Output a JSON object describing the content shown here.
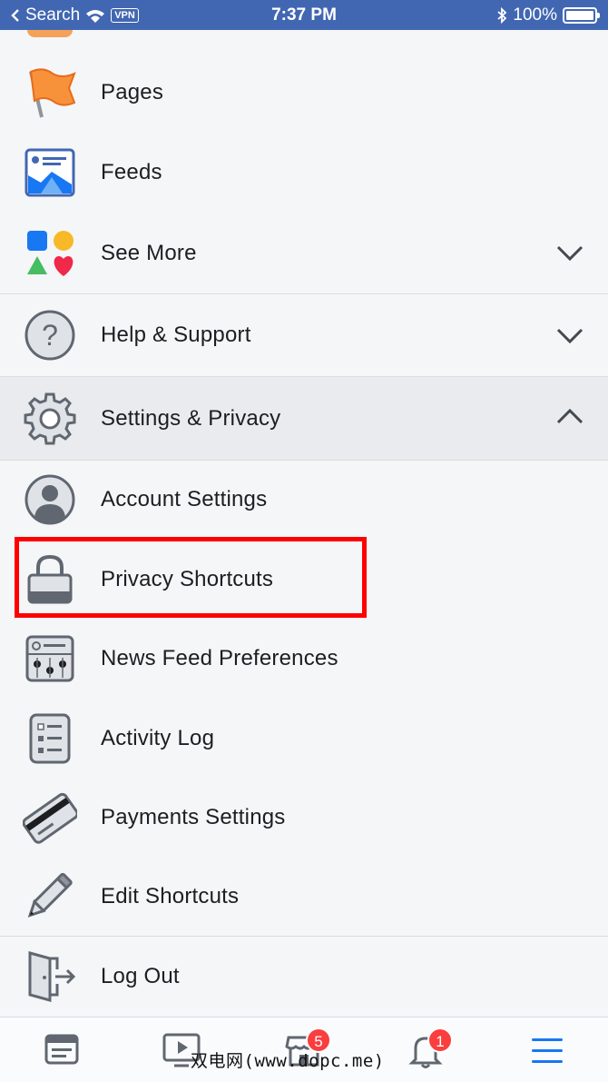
{
  "status_bar": {
    "carrier": "Search",
    "vpn": "VPN",
    "time": "7:37 PM",
    "battery": "100%",
    "icons": [
      "back-arrow-icon",
      "wifi-icon",
      "bluetooth-icon",
      "battery-icon"
    ]
  },
  "menu": {
    "items": [
      {
        "label": "Pages",
        "icon": "flag-icon"
      },
      {
        "label": "Feeds",
        "icon": "feeds-icon"
      },
      {
        "label": "See More",
        "icon": "shapes-icon",
        "chevron": "down"
      },
      {
        "label": "Help & Support",
        "icon": "question-icon",
        "chevron": "down"
      },
      {
        "label": "Settings & Privacy",
        "icon": "gear-icon",
        "chevron": "up",
        "expanded": true
      },
      {
        "label": "Account Settings",
        "icon": "person-icon"
      },
      {
        "label": "Privacy Shortcuts",
        "icon": "lock-icon",
        "highlighted": true
      },
      {
        "label": "News Feed Preferences",
        "icon": "sliders-icon"
      },
      {
        "label": "Activity Log",
        "icon": "list-icon"
      },
      {
        "label": "Payments Settings",
        "icon": "credit-card-icon"
      },
      {
        "label": "Edit Shortcuts",
        "icon": "pencil-icon"
      },
      {
        "label": "Log Out",
        "icon": "door-exit-icon"
      }
    ]
  },
  "tab_bar": {
    "tabs": [
      {
        "name": "news-feed",
        "icon": "news-feed-icon"
      },
      {
        "name": "watch",
        "icon": "video-play-icon"
      },
      {
        "name": "marketplace",
        "icon": "store-icon",
        "badge": "5"
      },
      {
        "name": "notifications",
        "icon": "bell-icon",
        "badge": "1"
      },
      {
        "name": "menu",
        "icon": "hamburger-menu-icon",
        "active": true
      }
    ]
  },
  "watermark": "双电网(www.dopc.me)",
  "colors": {
    "brand_blue": "#4267b2",
    "active_tab": "#1877f2",
    "highlight_border": "#ff0000",
    "badge": "#fa3e3e",
    "expanded_row_bg": "#e9ebee"
  }
}
